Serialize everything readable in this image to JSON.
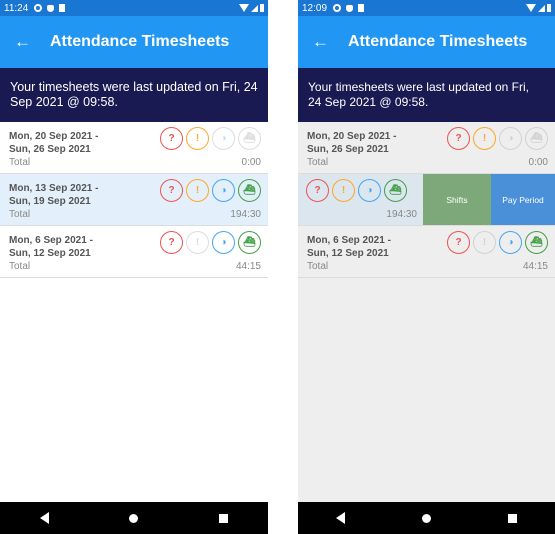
{
  "screens": [
    {
      "status_time": "11:24",
      "title": "Attendance Timesheets",
      "back": "←",
      "banner": "Your timesheets were last updated on Fri, 24 Sep 2021 @ 09:58.",
      "rows": [
        {
          "line1": "Mon, 20 Sep 2021 -",
          "line2": "Sun, 26 Sep 2021",
          "total_label": "Total",
          "total": "0:00"
        },
        {
          "line1": "Mon, 13 Sep 2021 -",
          "line2": "Sun, 19 Sep 2021",
          "total_label": "Total",
          "total": "194:30"
        },
        {
          "line1": "Mon, 6 Sep 2021 -",
          "line2": "Sun, 12 Sep 2021",
          "total_label": "Total",
          "total": "44:15"
        }
      ]
    },
    {
      "status_time": "12:09",
      "title": "Attendance Timesheets",
      "back": "←",
      "banner": "Your timesheets were last updated on Fri, 24 Sep 2021 @ 09:58.",
      "rows": [
        {
          "line1": "Mon, 20 Sep 2021 -",
          "line2": "Sun, 26 Sep 2021",
          "total_label": "Total",
          "total": "0:00"
        },
        {
          "total": "194:30",
          "action_shifts": "Shifts",
          "action_pay": "Pay Period"
        },
        {
          "line1": "Mon, 6 Sep 2021 -",
          "line2": "Sun, 12 Sep 2021",
          "total_label": "Total",
          "total": "44:15"
        }
      ]
    }
  ],
  "icon_colors": {
    "timer": "#ef5350",
    "clock": "#ffa726",
    "meal": "#42a5f5",
    "travel": "#43a047"
  },
  "icon_names": [
    "timer-question-icon",
    "clock-alert-icon",
    "meal-icon",
    "ship-icon"
  ],
  "icon_glyphs": {
    "timer": "◷",
    "clock": "◔",
    "meal": "◑",
    "travel": "⛴"
  },
  "colors": {
    "appbar": "#2196f3",
    "statusbar": "#1976d2",
    "banner": "#1a1a52",
    "highlight": "#e3f0fb",
    "shifts": "#7da87a",
    "pay": "#4a90d9"
  }
}
